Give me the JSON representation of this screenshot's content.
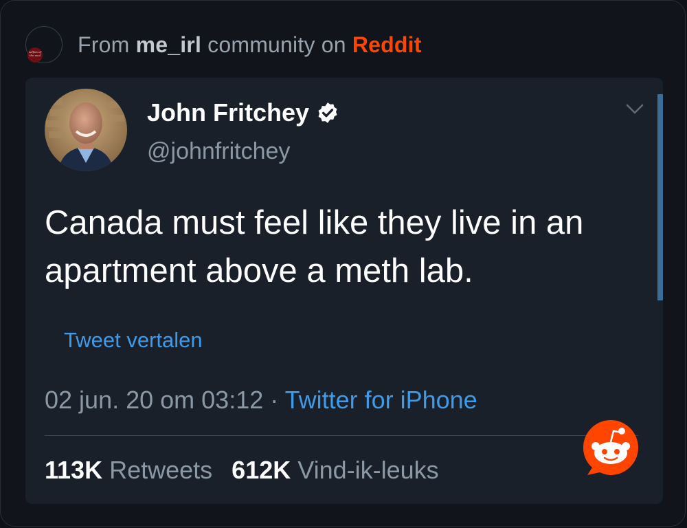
{
  "header": {
    "from_prefix": "From",
    "community": "me_irl",
    "middle": "community on",
    "platform": "Reddit",
    "avatar_badge_text": "selfies of the soul"
  },
  "tweet": {
    "author_name": "John Fritchey",
    "handle": "@johnfritchey",
    "text": "Canada must feel like they live in an apartment above a meth lab.",
    "translate_label": "Tweet vertalen",
    "timestamp": "02 jun. 20 om 03:12",
    "separator": " · ",
    "source": "Twitter for iPhone",
    "retweets_count": "113K",
    "retweets_label": "Retweets",
    "likes_count": "612K",
    "likes_label": "Vind-ik-leuks"
  },
  "icons": {
    "verified": "verified-badge-icon",
    "chevron": "chevron-down-icon",
    "reddit": "reddit-snoo-icon"
  },
  "colors": {
    "background": "#11151b",
    "card": "#192029",
    "accent_blue": "#3d9be9",
    "reddit_orange": "#ff4500",
    "muted_text": "#8b98a5"
  }
}
